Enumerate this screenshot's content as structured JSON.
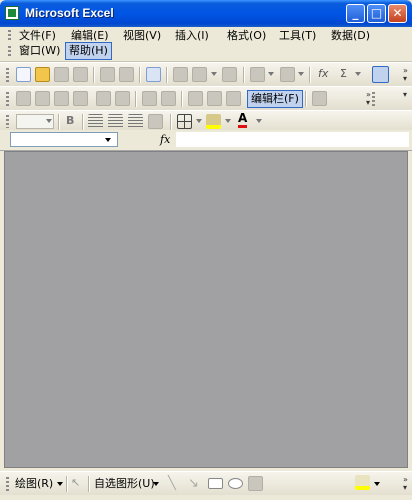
{
  "window": {
    "title": "Microsoft Excel"
  },
  "title_buttons": {
    "minimize": "_",
    "maximize": "□",
    "close": "✕"
  },
  "menu": {
    "row1": [
      {
        "label": "文件(F)"
      },
      {
        "label": "编辑(E)"
      },
      {
        "label": "视图(V)"
      },
      {
        "label": "插入(I)"
      },
      {
        "label": "格式(O)"
      },
      {
        "label": "工具(T)"
      },
      {
        "label": "数据(D)"
      }
    ],
    "row2": [
      {
        "label": "窗口(W)"
      },
      {
        "label": "帮助(H)",
        "active": true
      }
    ]
  },
  "toolbar2": {
    "edit_bar_label": "编辑栏(F)"
  },
  "formula": {
    "fx_label": "fx",
    "value": ""
  },
  "formatting": {
    "bold": "B",
    "font_color_glyph": "A"
  },
  "standard": {
    "sum_glyph": "Σ",
    "fx_glyph": "fx"
  },
  "drawing": {
    "draw_label": "绘图(R)",
    "autoshapes_label": "自选图形(U)"
  },
  "colors": {
    "accent": "#316ac5",
    "title_blue": "#0055e5",
    "workspace": "#a1a1a3"
  }
}
